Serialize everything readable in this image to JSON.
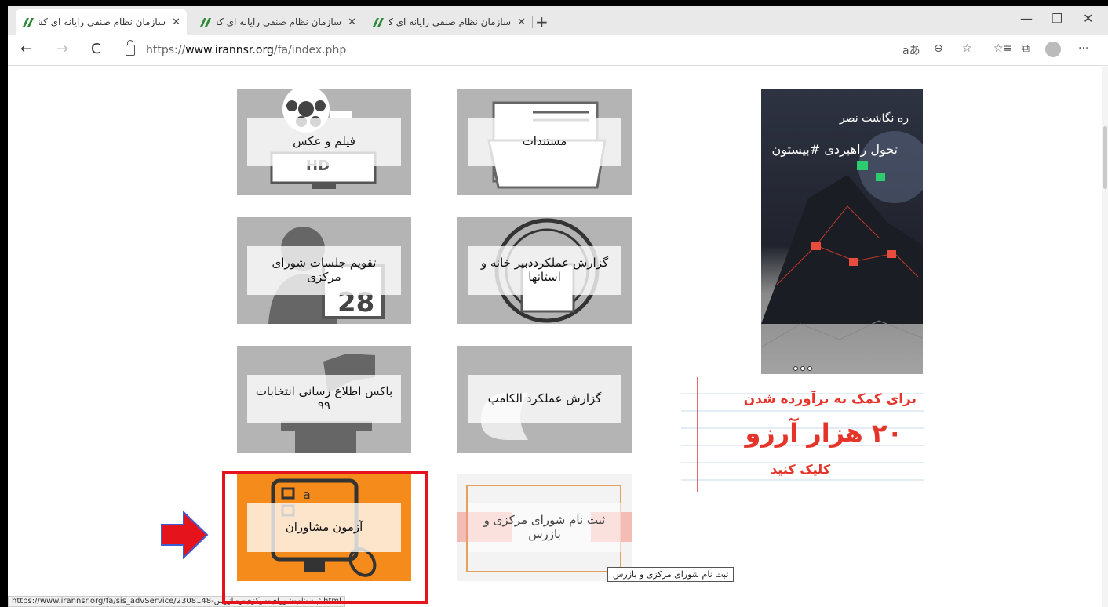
{
  "tabs": [
    {
      "title": "سازمان نظام صنفی رایانه ای کشور",
      "close": "✕"
    },
    {
      "title": "سازمان نظام صنفی رایانه ای کشور",
      "close": "✕"
    },
    {
      "title": "سازمان نظام صنفی رایانه ای کشور",
      "close": "✕"
    }
  ],
  "new_tab": "+",
  "window_controls": {
    "minimize": "—",
    "restore": "❐",
    "close": "✕"
  },
  "nav": {
    "back": "←",
    "forward": "→",
    "refresh": "C"
  },
  "address": {
    "scheme": "https://",
    "host": "www.irannsr.org",
    "path": "/fa/index.php"
  },
  "toolbar_icons": {
    "read_aloud": "aあ",
    "zoom": "⊖",
    "favorite_add": "☆",
    "favorites": "☆≡",
    "collections": "⧉",
    "more": "···"
  },
  "tiles": [
    {
      "label": "فیلم و عکس"
    },
    {
      "label": "مستندات"
    },
    {
      "label": "تقویم جلسات شورای مرکزی"
    },
    {
      "label": "گزارش عملکرددبیر خانه و استانها"
    },
    {
      "label": "باکس اطلاع رسانی انتخابات ۹۹"
    },
    {
      "label": "گزارش عملکرد الکامپ"
    },
    {
      "label": "آزمون مشاوران"
    },
    {
      "label": "ثبت نام شورای مرکزی و بازرس"
    }
  ],
  "banner_tall": {
    "line1": "ره نگاشت نصر",
    "line2": "تحول راهبردی #بیستون"
  },
  "banner_note": {
    "line1": "برای کمک به برآورده شدن",
    "line2": "۲۰ هزار آرزو",
    "line3": "کلیک کنید"
  },
  "tooltip": "ثبت نام شورای مرکزی و بازرس",
  "status_url": "https://www.irannsr.org/fa/sis_advService/2308148-ثبت-نام-شورای-مرکزی-و-بازرس.html",
  "colors": {
    "highlight": "#e5131c",
    "orange_tile": "#f48b1a",
    "gray_tile": "#b4b4b4"
  }
}
